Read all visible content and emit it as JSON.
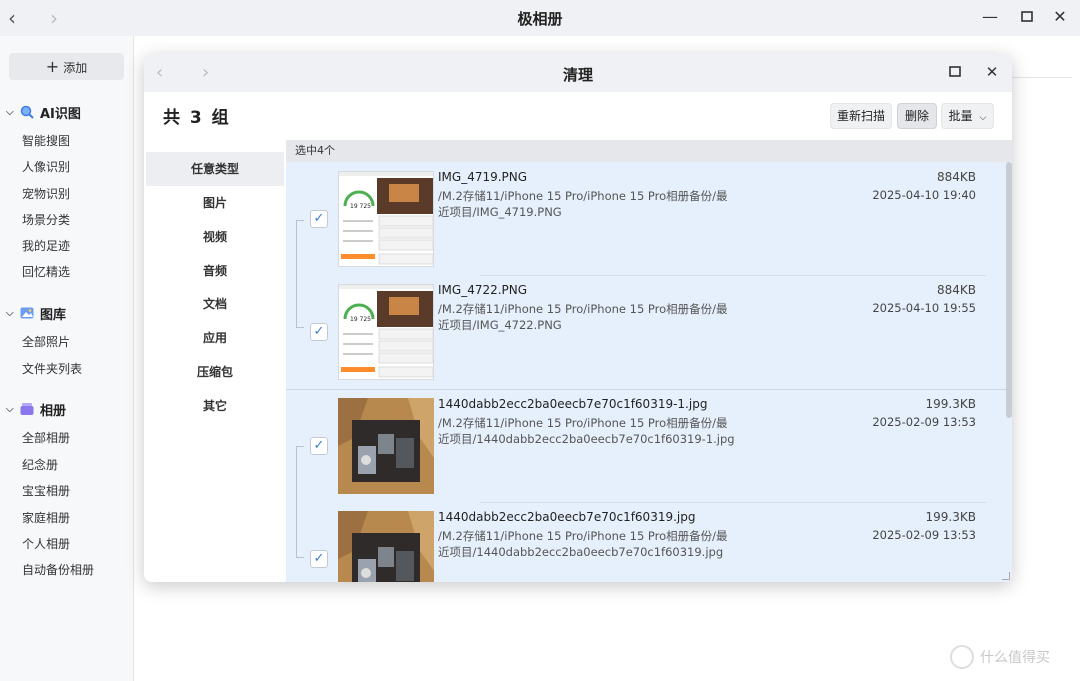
{
  "app": {
    "title": "极相册",
    "back_icon": "‹",
    "forward_icon": "›"
  },
  "window_controls": {
    "minimize": "—",
    "maximize": "☐",
    "close": "✕"
  },
  "sidebar": {
    "add_label": "添加",
    "sections": [
      {
        "title": "AI识图",
        "icon": "ai-search-icon",
        "color": "#4a8df0",
        "items": [
          "智能搜图",
          "人像识别",
          "宠物识别",
          "场景分类",
          "我的足迹",
          "回忆精选"
        ]
      },
      {
        "title": "图库",
        "icon": "gallery-icon",
        "color": "#5b8def",
        "items": [
          "全部照片",
          "文件夹列表"
        ]
      },
      {
        "title": "相册",
        "icon": "album-icon",
        "color": "#8e7cf0",
        "items": [
          "全部相册",
          "纪念册",
          "宝宝相册",
          "家庭相册",
          "个人相册",
          "自动备份相册"
        ]
      }
    ]
  },
  "dialog": {
    "title": "清理",
    "group_count": "共 3 组",
    "buttons": {
      "rescan": "重新扫描",
      "delete": "删除",
      "batch": "批量"
    },
    "categories": [
      "任意类型",
      "图片",
      "视频",
      "音频",
      "文档",
      "应用",
      "压缩包",
      "其它"
    ],
    "active_category": 0,
    "selected_text": "选中4个",
    "files": [
      {
        "name": "IMG_4719.PNG",
        "path": "/M.2存储11/iPhone 15 Pro/iPhone 15 Pro相册备份/最近项目/IMG_4719.PNG",
        "size": "884KB",
        "date": "2025-04-10 19:40",
        "checked": true,
        "thumb": "screenshot"
      },
      {
        "name": "IMG_4722.PNG",
        "path": "/M.2存储11/iPhone 15 Pro/iPhone 15 Pro相册备份/最近项目/IMG_4722.PNG",
        "size": "884KB",
        "date": "2025-04-10 19:55",
        "checked": true,
        "thumb": "screenshot"
      },
      {
        "name": "1440dabb2ecc2ba0eecb7e70c1f60319-1.jpg",
        "path": "/M.2存储11/iPhone 15 Pro/iPhone 15 Pro相册备份/最近项目/1440dabb2ecc2ba0eecb7e70c1f60319-1.jpg",
        "size": "199.3KB",
        "date": "2025-02-09 13:53",
        "checked": true,
        "thumb": "box-photo"
      },
      {
        "name": "1440dabb2ecc2ba0eecb7e70c1f60319.jpg",
        "path": "/M.2存储11/iPhone 15 Pro/iPhone 15 Pro相册备份/最近项目/1440dabb2ecc2ba0eecb7e70c1f60319.jpg",
        "size": "199.3KB",
        "date": "2025-02-09 13:53",
        "checked": true,
        "thumb": "box-photo"
      }
    ]
  },
  "thumb_screenshot": {
    "score": "19 725"
  },
  "watermark": {
    "text": "什么值得买"
  }
}
